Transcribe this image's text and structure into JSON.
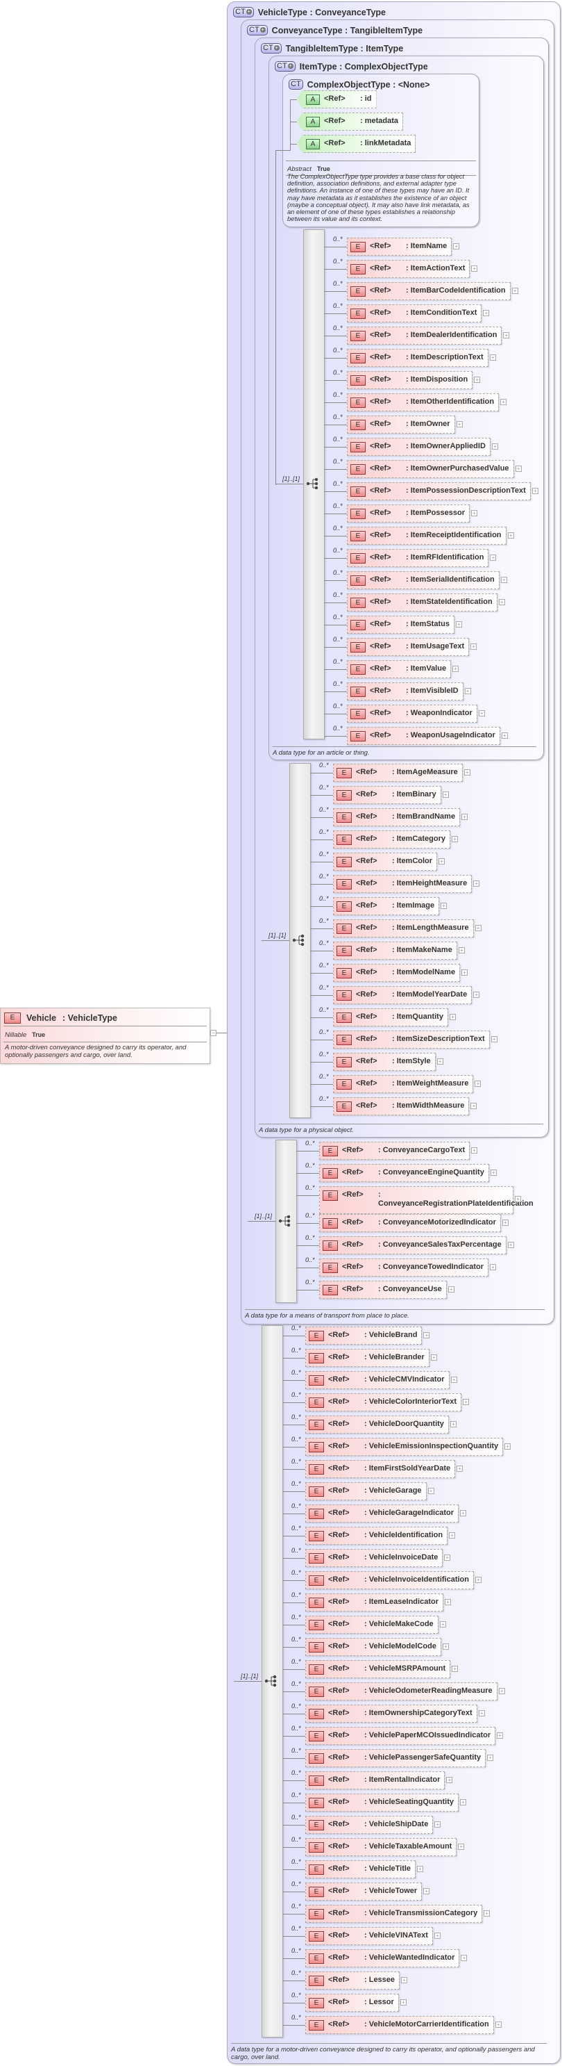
{
  "root_element": {
    "badge": "E",
    "name": "Vehicle",
    "type": ": VehicleType",
    "nillable_label": "Nillable",
    "nillable_value": "True",
    "description": "A motor-driven conveyance designed to carry its operator, and optionally passengers and cargo, over land."
  },
  "types": {
    "vehicle": {
      "badge": "CT",
      "title": "VehicleType : ConveyanceType",
      "description": "A data type for a motor-driven conveyance designed to carry its operator, and optionally passengers and cargo, over land."
    },
    "conveyance": {
      "badge": "CT",
      "title": "ConveyanceType : TangibleItemType",
      "description": "A data type for a means of transport from place to place."
    },
    "tangible": {
      "badge": "CT",
      "title": "TangibleItemType : ItemType",
      "description": "A data type for a physical object."
    },
    "item": {
      "badge": "CT",
      "title": "ItemType : ComplexObjectType",
      "description": "A data type for an article or thing."
    },
    "complex": {
      "badge": "CT",
      "title": "ComplexObjectType : <None>",
      "abstract_label": "Abstract",
      "abstract_value": "True",
      "description": "The ComplexObjectType type provides a base class for object definition, association definitions, and external adapter type definitions. An instance of one of these types may have an ID. It may have metadata as it establishes the existence of an object (maybe a conceptual object). It may also have link metadata, as an element of one of these types establishes a relationship between its value and its context.",
      "attributes": [
        {
          "badge": "A",
          "ref": "<Ref>",
          "name": ": id"
        },
        {
          "badge": "A",
          "ref": "<Ref>",
          "name": ": metadata"
        },
        {
          "badge": "A",
          "ref": "<Ref>",
          "name": ": linkMetadata"
        }
      ]
    }
  },
  "sequence_multiplicity": "[1]..[1]",
  "element_cardinality": "0..*",
  "element_badge": "E",
  "ref_label": "<Ref>",
  "expand_glyph": "+",
  "lists": {
    "item": [
      ": ItemName",
      ": ItemActionText",
      ": ItemBarCodeIdentification",
      ": ItemConditionText",
      ": ItemDealerIdentification",
      ": ItemDescriptionText",
      ": ItemDisposition",
      ": ItemOtherIdentification",
      ": ItemOwner",
      ": ItemOwnerAppliedID",
      ": ItemOwnerPurchasedValue",
      ": ItemPossessionDescriptionText",
      ": ItemPossessor",
      ": ItemReceiptIdentification",
      ": ItemRFIdentification",
      ": ItemSerialIdentification",
      ": ItemStateIdentification",
      ": ItemStatus",
      ": ItemUsageText",
      ": ItemValue",
      ": ItemVisibleID",
      ": WeaponIndicator",
      ": WeaponUsageIndicator"
    ],
    "tangible": [
      ": ItemAgeMeasure",
      ": ItemBinary",
      ": ItemBrandName",
      ": ItemCategory",
      ": ItemColor",
      ": ItemHeightMeasure",
      ": ItemImage",
      ": ItemLengthMeasure",
      ": ItemMakeName",
      ": ItemModelName",
      ": ItemModelYearDate",
      ": ItemQuantity",
      ": ItemSizeDescriptionText",
      ": ItemStyle",
      ": ItemWeightMeasure",
      ": ItemWidthMeasure"
    ],
    "conveyance": [
      ": ConveyanceCargoText",
      ": ConveyanceEngineQuantity",
      ": ConveyanceRegistrationPlateIdentification",
      ": ConveyanceMotorizedIndicator",
      ": ConveyanceSalesTaxPercentage",
      ": ConveyanceTowedIndicator",
      ": ConveyanceUse"
    ],
    "vehicle": [
      ": VehicleBrand",
      ": VehicleBrander",
      ": VehicleCMVIndicator",
      ": VehicleColorInteriorText",
      ": VehicleDoorQuantity",
      ": VehicleEmissionInspectionQuantity",
      ": ItemFirstSoldYearDate",
      ": VehicleGarage",
      ": VehicleGarageIndicator",
      ": VehicleIdentification",
      ": VehicleInvoiceDate",
      ": VehicleInvoiceIdentification",
      ": ItemLeaseIndicator",
      ": VehicleMakeCode",
      ": VehicleModelCode",
      ": VehicleMSRPAmount",
      ": VehicleOdometerReadingMeasure",
      ": ItemOwnershipCategoryText",
      ": VehiclePaperMCOIssuedIndicator",
      ": VehiclePassengerSafeQuantity",
      ": ItemRentalIndicator",
      ": VehicleSeatingQuantity",
      ": VehicleShipDate",
      ": VehicleTaxableAmount",
      ": VehicleTitle",
      ": VehicleTower",
      ": VehicleTransmissionCategory",
      ": VehicleVINAText",
      ": VehicleWantedIndicator",
      ": Lessee",
      ": Lessor",
      ": VehicleMotorCarrierIdentification"
    ]
  }
}
